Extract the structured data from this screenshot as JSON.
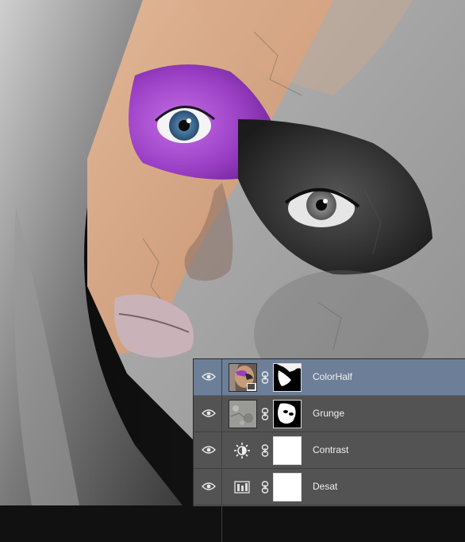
{
  "layers": [
    {
      "name": "ColorHalf",
      "selected": true,
      "icon": "smart-object-thumbnail"
    },
    {
      "name": "Grunge",
      "selected": false,
      "icon": "texture-thumbnail"
    },
    {
      "name": "Contrast",
      "selected": false,
      "icon": "brightness-adjustment-icon"
    },
    {
      "name": "Desat",
      "selected": false,
      "icon": "channel-mixer-adjustment-icon"
    }
  ],
  "colors": {
    "panel_bg": "#535353",
    "selected_row": "#6d7f98",
    "purple_makeup": "#9a3fc4",
    "skin_tone": "#d9a886"
  }
}
